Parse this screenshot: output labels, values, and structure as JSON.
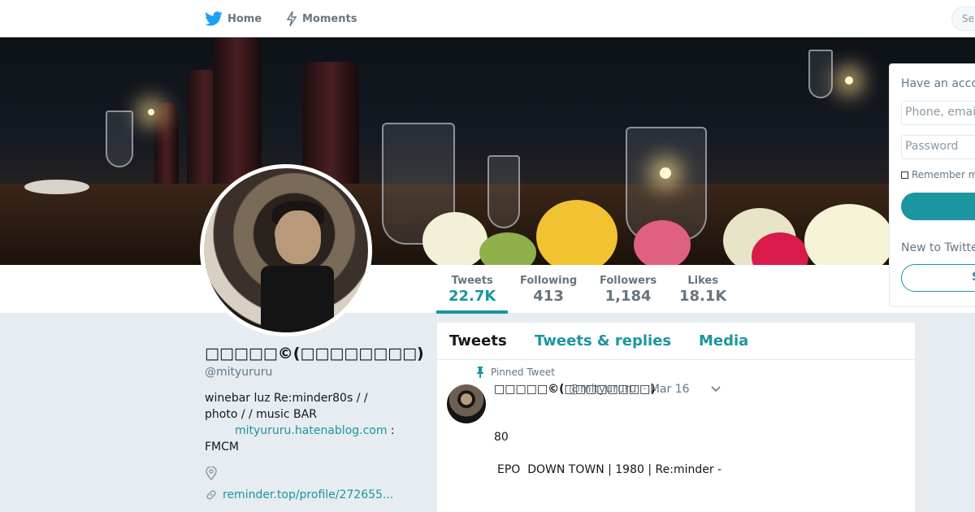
{
  "nav": {
    "home_label": "Home",
    "moments_label": "Moments",
    "search_placeholder": "Se",
    "have_account_hint": "Ha"
  },
  "colors": {
    "accent": "#1b95a0",
    "text_secondary": "#657786",
    "background": "#e6ecf0"
  },
  "stats": {
    "tweets_label": "Tweets",
    "tweets_value": "22.7K",
    "following_label": "Following",
    "following_value": "413",
    "followers_label": "Followers",
    "followers_value": "1,184",
    "likes_label": "Likes",
    "likes_value": "18.1K"
  },
  "profile": {
    "name": "□□□□□©(□□□□□□□□)",
    "handle": "@mityururu",
    "bio_line1": "winebar luz Re:minder80s /  /",
    "bio_line2": "photo / / music BAR",
    "bio_link": "mityururu.hatenablog.com",
    "bio_after_link": " :",
    "bio_line4": "FMCM",
    "url": "reminder.top/profile/272655..."
  },
  "timeline": {
    "tab_tweets": "Tweets",
    "tab_replies": "Tweets & replies",
    "tab_media": "Media",
    "pinned_label": "Pinned Tweet",
    "tweet_name": "□□□□□©(□□□□□□□□)",
    "tweet_handle": "@mityururu",
    "tweet_time": "· Mar 16",
    "tweet_line1": "80",
    "tweet_line2": "EPO  DOWN TOWN | 1980 | Re:minder -"
  },
  "login": {
    "title": "Have an acco",
    "phone_placeholder": "Phone, emai",
    "password_placeholder": "Password",
    "remember": "Remember m",
    "new_to": "New to Twitte",
    "signup_partial": "S"
  }
}
